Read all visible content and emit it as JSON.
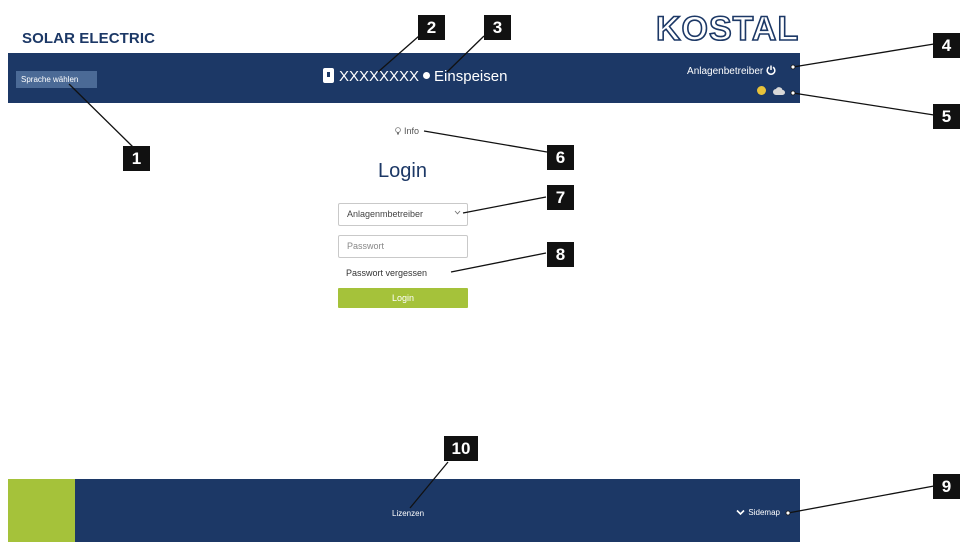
{
  "header": {
    "brand": "SOLAR ELECTRIC",
    "logo": "KOSTAL",
    "language_button": "Sprache wählen",
    "device_name": "XXXXXXXX",
    "device_status": "Einspeisen",
    "operator_label": "Anlagenbetreiber",
    "icons": [
      "inverter-icon",
      "power-icon",
      "globe-icon",
      "cloud-icon"
    ]
  },
  "login": {
    "info_label": "Info",
    "title": "Login",
    "role_selected": "Anlagenmbetreiber",
    "password_placeholder": "Passwort",
    "forgot_link": "Passwort vergessen",
    "login_button": "Login"
  },
  "footer": {
    "licenses_link": "Lizenzen",
    "sitemap_link": "Sidemap"
  },
  "callouts": [
    "1",
    "2",
    "3",
    "4",
    "5",
    "6",
    "7",
    "8",
    "9",
    "10"
  ],
  "colors": {
    "navy": "#1c3866",
    "lime": "#a5c23a",
    "lang_button": "#4b6a96",
    "status_icon_yellow": "#e8c23a"
  }
}
